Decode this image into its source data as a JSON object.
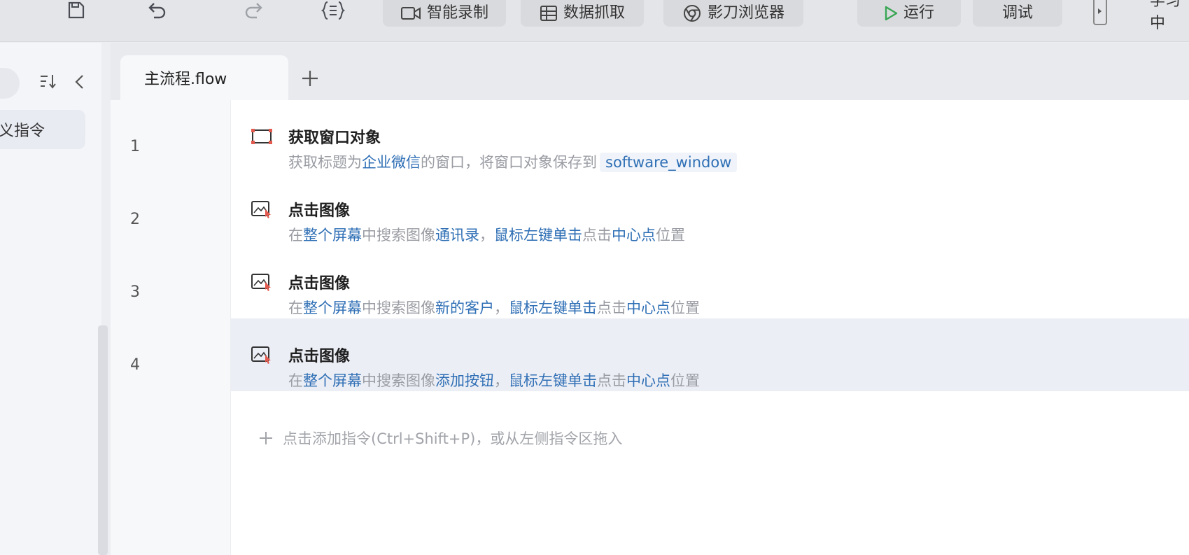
{
  "toolbar": {
    "icons": {
      "save": "save-icon",
      "undo": "undo-icon",
      "redo": "redo-icon",
      "code": "code-braces-icon"
    },
    "smart_record_label": "智能录制",
    "data_scrape_label": "数据抓取",
    "browser_label": "影刀浏览器",
    "run_label": "运行",
    "debug_label": "调试",
    "learn_label": "学习中"
  },
  "sidebar": {
    "item_label": "义指令"
  },
  "tabs": {
    "active_label": "主流程.flow"
  },
  "steps": [
    {
      "line": "1",
      "icon": "window-object-icon",
      "title": "获取窗口对象",
      "desc": [
        {
          "t": "获取标题为",
          "hl": false
        },
        {
          "t": "企业微信",
          "hl": true
        },
        {
          "t": "的窗口，将窗口对象保存到",
          "hl": false
        }
      ],
      "variable": "software_window"
    },
    {
      "line": "2",
      "icon": "click-image-icon",
      "title": "点击图像",
      "desc": [
        {
          "t": "在",
          "hl": false
        },
        {
          "t": "整个屏幕",
          "hl": true
        },
        {
          "t": "中搜索图像",
          "hl": false
        },
        {
          "t": "通讯录",
          "hl": true
        },
        {
          "t": "，",
          "hl": false
        },
        {
          "t": "鼠标左键单击",
          "hl": true
        },
        {
          "t": "点击",
          "hl": false
        },
        {
          "t": "中心点",
          "hl": true
        },
        {
          "t": "位置",
          "hl": false
        }
      ]
    },
    {
      "line": "3",
      "icon": "click-image-icon",
      "title": "点击图像",
      "desc": [
        {
          "t": "在",
          "hl": false
        },
        {
          "t": "整个屏幕",
          "hl": true
        },
        {
          "t": "中搜索图像",
          "hl": false
        },
        {
          "t": "新的客户",
          "hl": true
        },
        {
          "t": "，",
          "hl": false
        },
        {
          "t": "鼠标左键单击",
          "hl": true
        },
        {
          "t": "点击",
          "hl": false
        },
        {
          "t": "中心点",
          "hl": true
        },
        {
          "t": "位置",
          "hl": false
        }
      ]
    },
    {
      "line": "4",
      "icon": "click-image-icon",
      "title": "点击图像",
      "selected": true,
      "desc": [
        {
          "t": "在",
          "hl": false
        },
        {
          "t": "整个屏幕",
          "hl": true
        },
        {
          "t": "中搜索图像",
          "hl": false
        },
        {
          "t": "添加按钮",
          "hl": true
        },
        {
          "t": "，",
          "hl": false
        },
        {
          "t": "鼠标左键单击",
          "hl": true
        },
        {
          "t": "点击",
          "hl": false
        },
        {
          "t": "中心点",
          "hl": true
        },
        {
          "t": "位置",
          "hl": false
        }
      ]
    }
  ],
  "add_hint": "点击添加指令(Ctrl+Shift+P)，或从左侧指令区拖入",
  "colors": {
    "highlight": "#2f6fb5",
    "run_green": "#3aa655"
  }
}
